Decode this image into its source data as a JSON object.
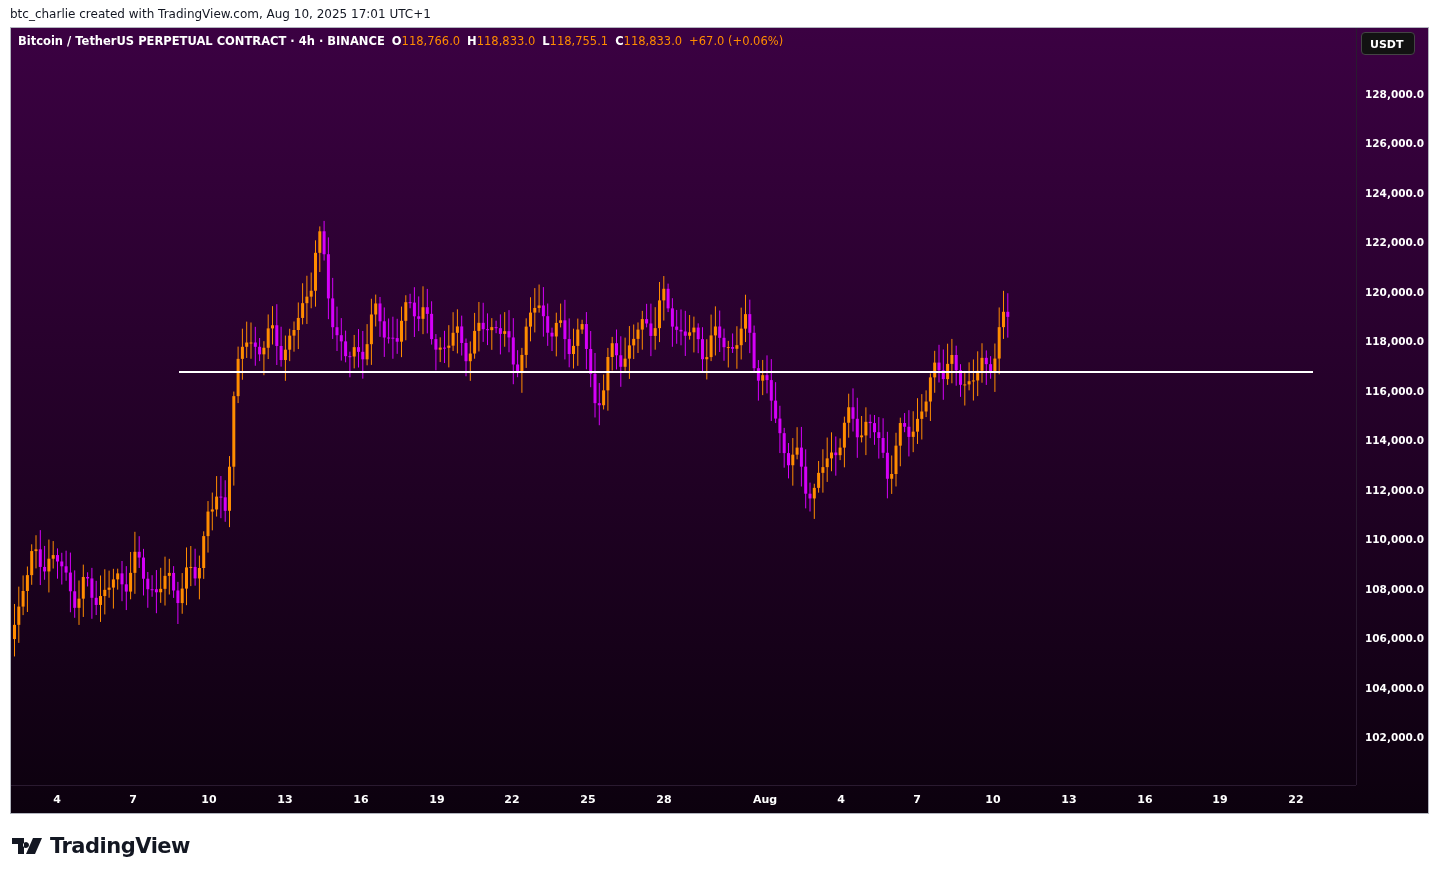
{
  "caption": "btc_charlie created with TradingView.com, Aug 10, 2025 17:01 UTC+1",
  "chart": {
    "legend": {
      "symbol": "Bitcoin / TetherUS PERPETUAL CONTRACT · 4h · BINANCE",
      "ohlc": [
        {
          "key": "O",
          "value": "118,766.0"
        },
        {
          "key": "H",
          "value": "118,833.0"
        },
        {
          "key": "L",
          "value": "118,755.1"
        },
        {
          "key": "C",
          "value": "118,833.0"
        }
      ],
      "change": "+67.0 (+0.06%)"
    },
    "currency": "USDT",
    "price_labels": [
      "128,000.0",
      "126,000.0",
      "124,000.0",
      "122,000.0",
      "120,000.0",
      "118,000.0",
      "116,000.0",
      "114,000.0",
      "112,000.0",
      "110,000.0",
      "108,000.0",
      "106,000.0",
      "104,000.0",
      "102,000.0"
    ],
    "time_labels": [
      "4",
      "7",
      "10",
      "13",
      "16",
      "19",
      "22",
      "25",
      "28",
      "Aug",
      "4",
      "7",
      "10",
      "13",
      "16",
      "19",
      "22"
    ]
  },
  "footer": {
    "logo": "TradingView"
  }
}
